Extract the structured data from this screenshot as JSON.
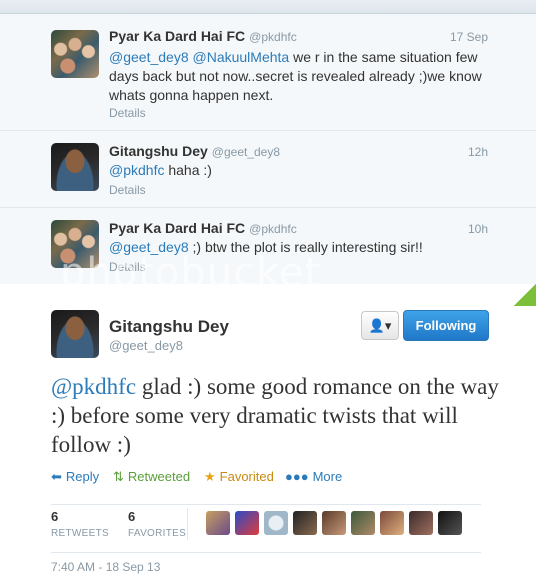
{
  "conversation": [
    {
      "name": "Pyar Ka Dard Hai FC",
      "handle": "@pkdhfc",
      "time": "17 Sep",
      "mentions": "@geet_dey8 @NakuulMehta",
      "text": " we r in the same situation few days back but not now..secret is revealed already ;)we know whats gonna happen next.",
      "details": "Details"
    },
    {
      "name": "Gitangshu Dey",
      "handle": "@geet_dey8",
      "time": "12h",
      "mentions": "@pkdhfc",
      "text": " haha :)",
      "details": "Details"
    },
    {
      "name": "Pyar Ka Dard Hai FC",
      "handle": "@pkdhfc",
      "time": "10h",
      "mentions": "@geet_dey8",
      "text": " ;) btw the plot is really interesting sir!!",
      "details": "Details"
    }
  ],
  "watermark": "photobucket",
  "main_tweet": {
    "name": "Gitangshu Dey",
    "handle": "@geet_dey8",
    "follow_label": "Following",
    "user_menu_icon": "user-dropdown-icon",
    "mention": "@pkdhfc",
    "text": " glad :) some good romance on the way :) before some very dramatic twists that will follow :)",
    "actions": {
      "reply": "Reply",
      "retweeted": "Retweeted",
      "favorited": "Favorited",
      "more": "More"
    },
    "stats": {
      "retweets_count": "6",
      "retweets_label": "RETWEETS",
      "favorites_count": "6",
      "favorites_label": "FAVORITES"
    },
    "timestamp": "7:40 AM - 18 Sep 13"
  },
  "colors": {
    "link": "#2b7bb9",
    "follow_button": "#2b8ad8",
    "retweet_green": "#5c9e3a",
    "favorite_gold": "#e8a317"
  }
}
